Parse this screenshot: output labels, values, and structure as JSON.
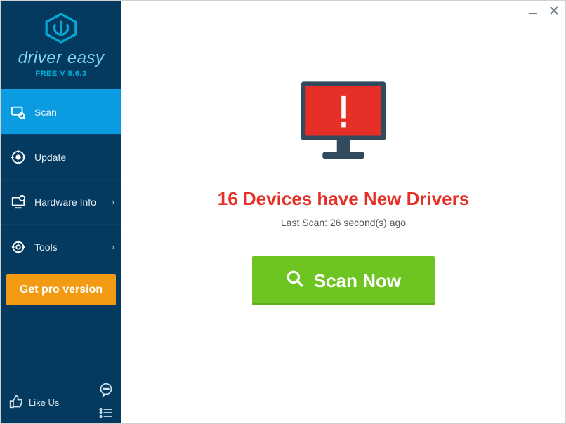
{
  "brand": {
    "name": "driver easy",
    "version_label": "FREE V 5.6.3"
  },
  "sidebar": {
    "items": [
      {
        "label": "Scan",
        "icon": "scan-icon",
        "active": true,
        "has_submenu": false
      },
      {
        "label": "Update",
        "icon": "update-icon",
        "active": false,
        "has_submenu": false
      },
      {
        "label": "Hardware Info",
        "icon": "hardware-icon",
        "active": false,
        "has_submenu": true
      },
      {
        "label": "Tools",
        "icon": "tools-icon",
        "active": false,
        "has_submenu": true
      }
    ],
    "pro_button": "Get pro version",
    "like_label": "Like Us"
  },
  "main": {
    "headline": "16 Devices have New Drivers",
    "last_scan": "Last Scan: 26 second(s) ago",
    "scan_button": "Scan Now"
  },
  "window": {
    "minimize": "minimize",
    "close": "close"
  }
}
